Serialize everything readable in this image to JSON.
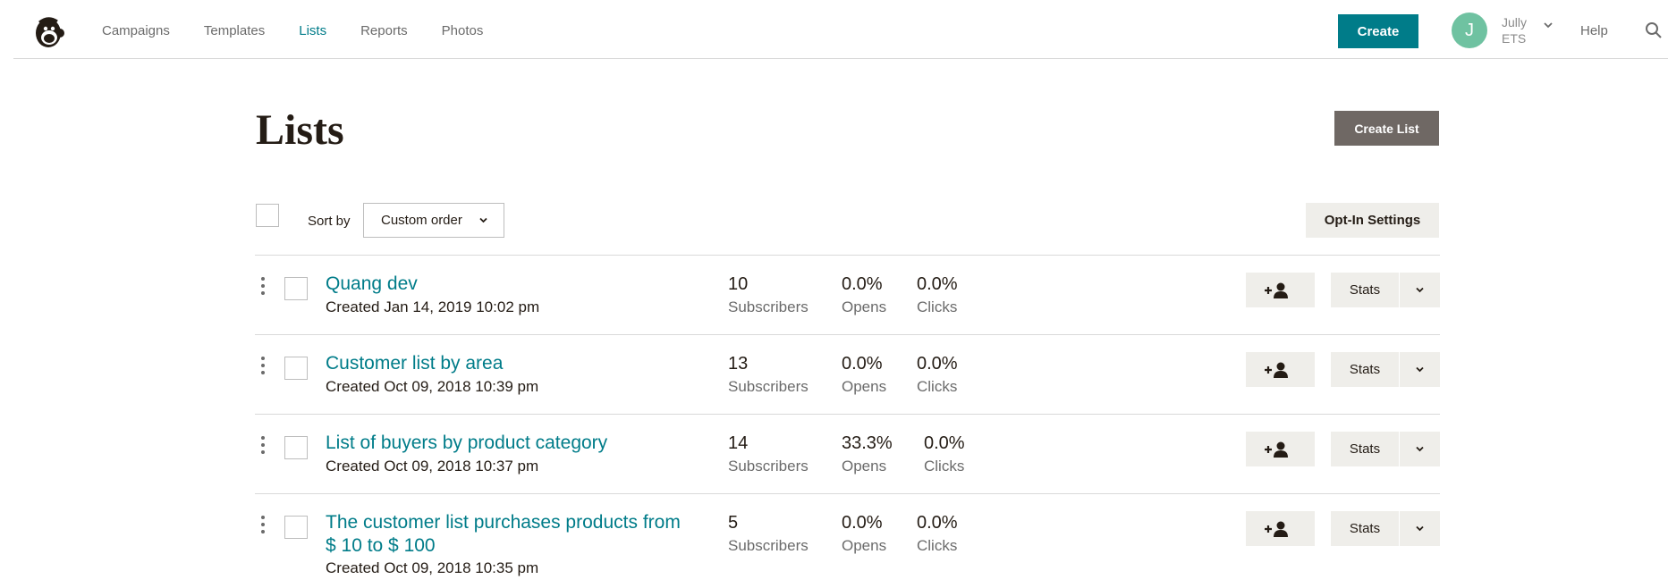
{
  "nav": {
    "links": [
      "Campaigns",
      "Templates",
      "Lists",
      "Reports",
      "Photos"
    ],
    "active": "Lists",
    "create_label": "Create",
    "user_initial": "J",
    "user_first": "Jully",
    "user_second": "ETS",
    "help_label": "Help"
  },
  "page": {
    "title": "Lists",
    "create_list_label": "Create List"
  },
  "toolbar": {
    "sort_label": "Sort by",
    "sort_value": "Custom order",
    "optin_label": "Opt-In Settings"
  },
  "lists": [
    {
      "name": "Quang dev",
      "created": "Created Jan 14, 2019 10:02 pm",
      "subscribers": "10",
      "subscribers_label": "Subscribers",
      "opens": "0.0%",
      "opens_label": "Opens",
      "clicks": "0.0%",
      "clicks_label": "Clicks",
      "stats_label": "Stats"
    },
    {
      "name": "Customer list by area",
      "created": "Created Oct 09, 2018 10:39 pm",
      "subscribers": "13",
      "subscribers_label": "Subscribers",
      "opens": "0.0%",
      "opens_label": "Opens",
      "clicks": "0.0%",
      "clicks_label": "Clicks",
      "stats_label": "Stats"
    },
    {
      "name": "List of buyers by product category",
      "created": "Created Oct 09, 2018 10:37 pm",
      "subscribers": "14",
      "subscribers_label": "Subscribers",
      "opens": "33.3%",
      "opens_label": "Opens",
      "clicks": "0.0%",
      "clicks_label": "Clicks",
      "stats_label": "Stats"
    },
    {
      "name": "The customer list purchases products from $ 10 to $ 100",
      "created": "Created Oct 09, 2018 10:35 pm",
      "subscribers": "5",
      "subscribers_label": "Subscribers",
      "opens": "0.0%",
      "opens_label": "Opens",
      "clicks": "0.0%",
      "clicks_label": "Clicks",
      "stats_label": "Stats"
    }
  ],
  "icons": {
    "logo": "mailchimp-freddie-logo",
    "search": "search-icon",
    "add_contact": "add-contact-icon",
    "chevron": "chevron-down-icon",
    "drag": "drag-handle-icon"
  },
  "colors": {
    "accent": "#007c89",
    "create_list_bg": "#6f6864",
    "button_bg": "#efeeea",
    "avatar_bg": "#6fc2a1"
  }
}
